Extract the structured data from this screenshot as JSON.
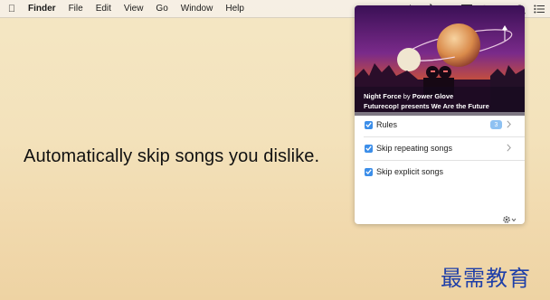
{
  "menubar": {
    "app_name": "Finder",
    "items": [
      "File",
      "Edit",
      "View",
      "Go",
      "Window",
      "Help"
    ],
    "status_icons": [
      "bluetooth-icon",
      "volume-icon",
      "display-icon",
      "wifi-icon",
      "user-icon",
      "spotlight-icon",
      "notification-center-icon"
    ]
  },
  "headline": "Automatically skip songs you dislike.",
  "player": {
    "track_title": "Night Force",
    "by_word": "by",
    "artist": "Power Glove",
    "album": "Futurecop! presents We Are the Future",
    "options": [
      {
        "label": "Rules",
        "checked": true,
        "badge": "3"
      },
      {
        "label": "Skip repeating songs",
        "checked": true
      },
      {
        "label": "Skip explicit songs",
        "checked": true
      }
    ]
  },
  "watermark": "最需教育",
  "colors": {
    "accent": "#3c8ee9",
    "badge": "#8ec1f2",
    "watermark": "#1f3fa8",
    "art_purple": "#5a1f7a",
    "art_orange": "#e8692a"
  }
}
